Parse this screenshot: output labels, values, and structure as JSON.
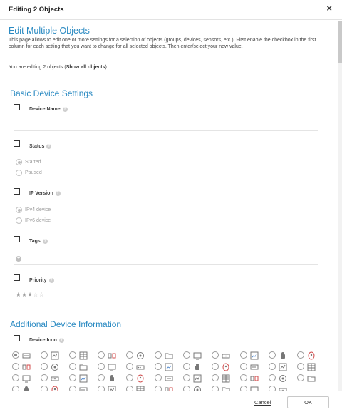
{
  "dialog": {
    "title": "Editing 2 Objects",
    "close_glyph": "×"
  },
  "main": {
    "heading": "Edit Multiple Objects",
    "intro": "This page allows to edit one or more settings for a selection of objects (groups, devices, sensors, etc.). First enable the checkbox in the first column for each setting that you want to change for all selected objects. Then enter/select your new value.",
    "editing_prefix": "You are editing 2 objects (",
    "show_all_link": "Show all objects",
    "editing_suffix": "):"
  },
  "basic": {
    "heading": "Basic Device Settings",
    "device_name": {
      "label": "Device Name",
      "value": ""
    },
    "status": {
      "label": "Status",
      "options": [
        "Started",
        "Paused"
      ],
      "selected": "Started"
    },
    "ip_version": {
      "label": "IP Version",
      "options": [
        "IPv4 device",
        "IPv6 device"
      ],
      "selected": "IPv4 device"
    },
    "tags": {
      "label": "Tags"
    },
    "priority": {
      "label": "Priority",
      "value": 3,
      "max": 5
    }
  },
  "additional": {
    "heading": "Additional Device Information",
    "device_icon": {
      "label": "Device Icon",
      "selected_index": 0,
      "icons": [
        "server-rack-icon",
        "chart-monitor-icon",
        "grid-panel-icon",
        "router-icon",
        "sensor-panel-icon",
        "folder-icon",
        "display-icon",
        "network-device-icon",
        "chart-window-icon",
        "android-robot-icon",
        "linux-tux-icon",
        "apple-icon",
        "stacked-windows-icon",
        "tool-icon",
        "monitor-box-icon",
        "tablet-icon",
        "laptop-icon",
        "rack-unit-icon",
        "switch-icon",
        "printer-icon",
        "printer-icon-2",
        "smartphone-icon",
        "webcam-icon",
        "globe-icon",
        "file-storage-icon",
        "speaker-icon",
        "phone-icon",
        "clock-icon",
        "wifi-router-icon",
        "ups-icon",
        "connector-icon",
        "monitor-alt-icon",
        "server-icon",
        "camera-icon",
        "usb-device-icon",
        "hardware-icon",
        "cloud-icon",
        "tool-icon-2",
        "disk-icon",
        "firewall-icon",
        "network-hub-icon",
        "alert-icon",
        "storage-array-icon"
      ]
    }
  },
  "colors": {
    "accent": "#2a8ac2",
    "icon": "#777777",
    "icon_red": "#d24b4b",
    "icon_blue": "#5a8fd0"
  },
  "footer": {
    "cancel": "Cancel",
    "ok": "OK"
  }
}
